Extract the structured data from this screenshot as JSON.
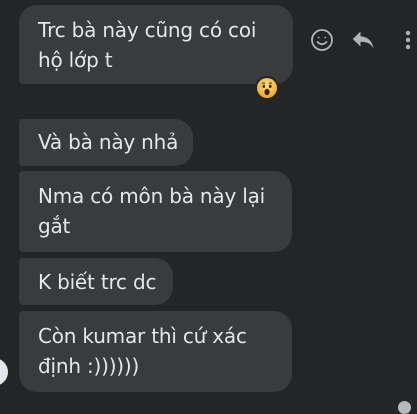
{
  "messages": [
    {
      "text": "Trc bà này cũng có coi\nhộ lớp t"
    },
    {
      "text": "Và bà này nhả"
    },
    {
      "text": "Nma có môn bà này lại\ngắt"
    },
    {
      "text": "K biết trc dc"
    },
    {
      "text": "Còn kumar thì cứ xác\nđịnh :))))))"
    }
  ],
  "reaction": {
    "emoji": "wow"
  },
  "actions": [
    {
      "icon": "smiley-icon"
    },
    {
      "icon": "reply-icon"
    },
    {
      "icon": "more-vertical-icon"
    }
  ],
  "colors": {
    "background": "#242526",
    "bubble": "#3a3b3c",
    "text": "#e4e6eb",
    "icon": "#b0b3b8",
    "emoji_yellow": "#f7b125"
  }
}
